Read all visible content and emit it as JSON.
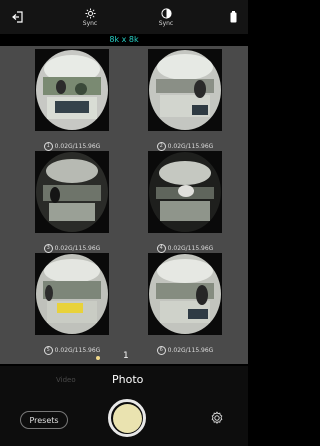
{
  "topbar": {
    "exit_icon": "exit-icon",
    "wb_sync_label": "Sync",
    "exposure_sync_label": "Sync",
    "battery_icon": "battery-icon"
  },
  "resolution": "8k x 8k",
  "thumbnails": [
    {
      "index": "1",
      "caption": "0.02G/115.96G"
    },
    {
      "index": "2",
      "caption": "0.02G/115.96G"
    },
    {
      "index": "3",
      "caption": "0.02G/115.96G"
    },
    {
      "index": "4",
      "caption": "0.02G/115.96G"
    },
    {
      "index": "5",
      "caption": "0.02G/115.96G"
    },
    {
      "index": "6",
      "caption": "0.02G/115.96G"
    }
  ],
  "pager": {
    "current": "1"
  },
  "modes": {
    "video_label": "Video",
    "photo_label": "Photo"
  },
  "presets_label": "Presets"
}
